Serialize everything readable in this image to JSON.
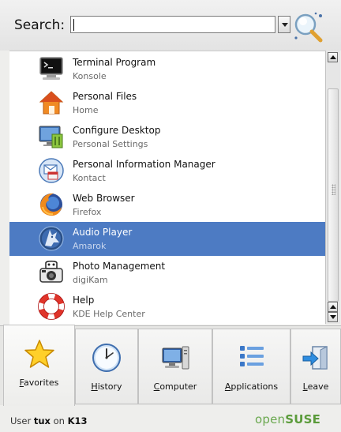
{
  "search": {
    "label": "Search:",
    "value": "",
    "placeholder": ""
  },
  "icons": {
    "search": "magnifier-search-icon",
    "dropdown": "chevron-down-icon"
  },
  "list_items": [
    {
      "title": "Terminal Program",
      "subtitle": "Konsole",
      "icon": "terminal-icon",
      "selected": false
    },
    {
      "title": "Personal Files",
      "subtitle": "Home",
      "icon": "home-folder-icon",
      "selected": false
    },
    {
      "title": "Configure Desktop",
      "subtitle": "Personal Settings",
      "icon": "desktop-settings-icon",
      "selected": false
    },
    {
      "title": "Personal Information Manager",
      "subtitle": "Kontact",
      "icon": "kontact-icon",
      "selected": false
    },
    {
      "title": "Web Browser",
      "subtitle": "Firefox",
      "icon": "firefox-icon",
      "selected": false
    },
    {
      "title": "Audio Player",
      "subtitle": "Amarok",
      "icon": "amarok-wolf-icon",
      "selected": true
    },
    {
      "title": "Photo Management",
      "subtitle": "digiKam",
      "icon": "camera-icon",
      "selected": false
    },
    {
      "title": "Help",
      "subtitle": "KDE Help Center",
      "icon": "lifebuoy-help-icon",
      "selected": false
    }
  ],
  "tabs": [
    {
      "label": "Favorites",
      "icon": "star-icon",
      "active": true
    },
    {
      "label": "History",
      "icon": "clock-icon",
      "active": false
    },
    {
      "label": "Computer",
      "icon": "computer-icon",
      "active": false
    },
    {
      "label": "Applications",
      "icon": "applications-list-icon",
      "active": false
    },
    {
      "label": "Leave",
      "icon": "leave-door-icon",
      "active": false
    }
  ],
  "footer": {
    "user_prefix": "User",
    "user_name": "tux",
    "host_prefix": "on",
    "host_name": "K13",
    "brand_open": "open",
    "brand_suse": "SUSE"
  },
  "colors": {
    "selection": "#4d7bc3",
    "brand_green": "#5a9b3a"
  }
}
